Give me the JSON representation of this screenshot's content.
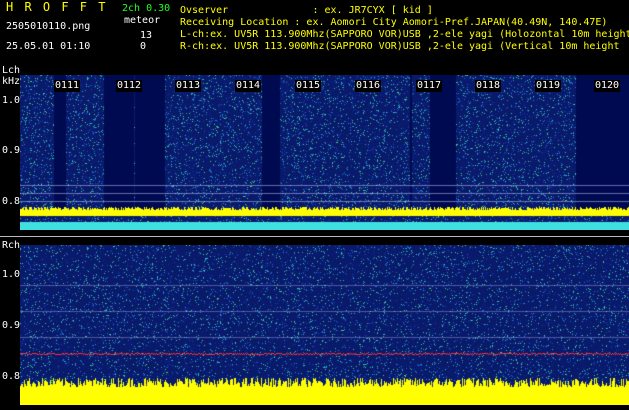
{
  "header": {
    "brand": "H R O F F T",
    "mode": "2ch 0.30",
    "type_label": "meteor",
    "filename": "2505010110.png",
    "count_top": "13",
    "count_bottom": "0",
    "datetime": "25.05.01 01:10",
    "observer": "Ovserver              : ex. JR7CYX [ kid ]",
    "location": "Receiving Location : ex. Aomori City Aomori-Pref.JAPAN(40.49N, 140.47E)",
    "lch_info": "L-ch:ex. UV5R 113.900Mhz(SAPPORO VOR)USB ,2-ele yagi (Holozontal 10m height",
    "rch_info": "R-ch:ex. UV5R 113.900Mhz(SAPPORO VOR)USB ,2-ele yagi (Vertical 10m height"
  },
  "lch": {
    "label": "Lch",
    "unit": "kHz",
    "ticks": [
      "1.0",
      "0.9",
      "0.8"
    ]
  },
  "rch": {
    "label": "Rch",
    "ticks": [
      "1.0",
      "0.9",
      "0.8"
    ]
  },
  "time_marks": [
    "0111",
    "0112",
    "0113",
    "0114",
    "0115",
    "0116",
    "0117",
    "0118",
    "0119",
    "0120"
  ],
  "colors": {
    "background": "#000000",
    "noise_blue": "#1030a0",
    "noise_cyan": "#20c0c0",
    "noise_green": "#40d070",
    "signal_yellow": "#ffff00",
    "carrier_red": "#ff3030",
    "text_green": "#22ff22"
  }
}
